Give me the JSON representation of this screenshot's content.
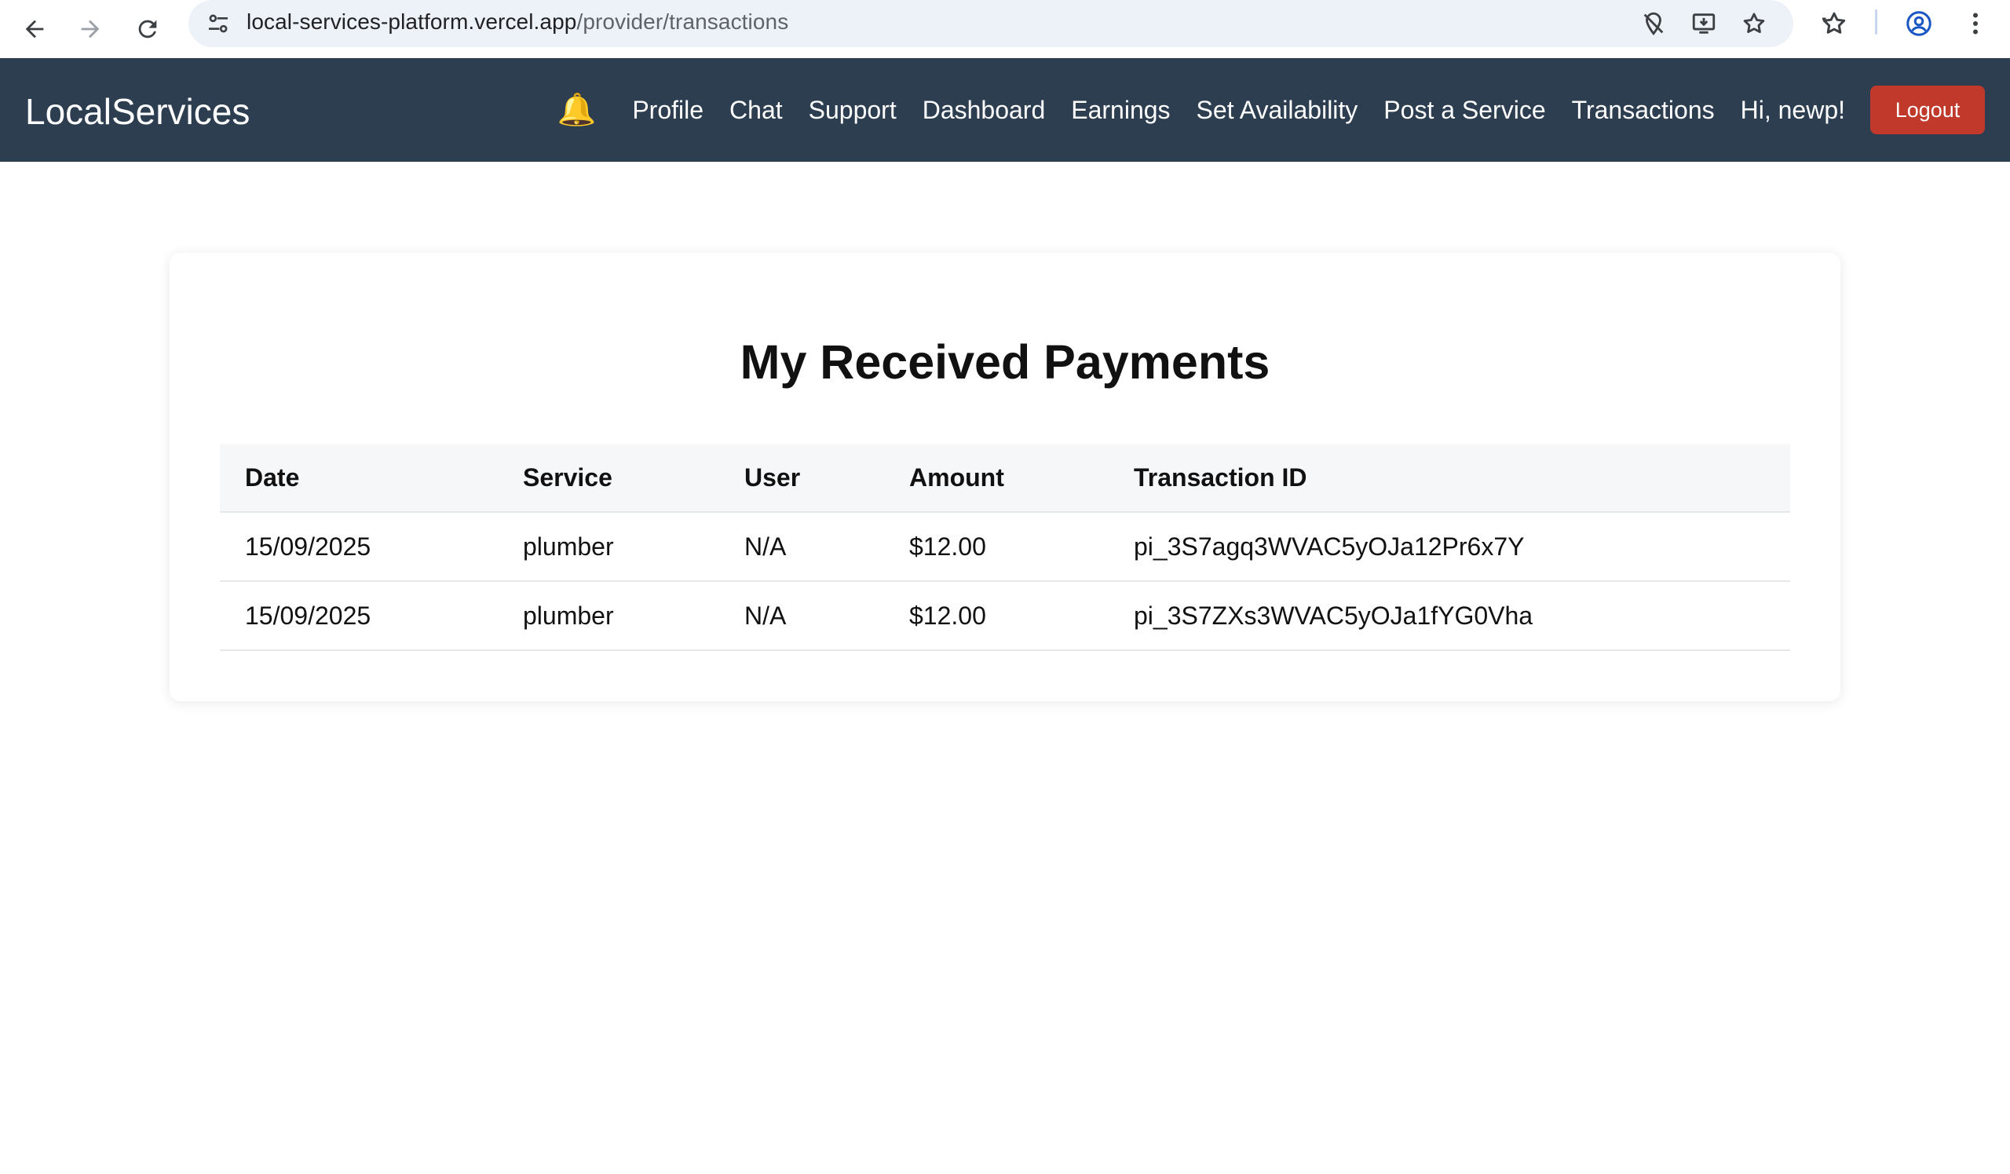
{
  "browser": {
    "url_host": "local-services-platform.vercel.app",
    "url_path": "/provider/transactions",
    "icons": [
      "back-icon",
      "forward-icon",
      "reload-icon",
      "site-settings-icon",
      "location-off-icon",
      "install-app-icon",
      "bookmark-star-icon",
      "bookmarks-icon",
      "profile-icon",
      "menu-icon"
    ]
  },
  "navbar": {
    "brand": "LocalServices",
    "bell": "🔔",
    "links": [
      "Profile",
      "Chat",
      "Support",
      "Dashboard",
      "Earnings",
      "Set Availability",
      "Post a Service",
      "Transactions"
    ],
    "greeting": "Hi, newp!",
    "logout_label": "Logout",
    "colors": {
      "background": "#2c3e50",
      "logout": "#c0392b"
    }
  },
  "main": {
    "title": "My Received Payments",
    "table": {
      "headers": [
        "Date",
        "Service",
        "User",
        "Amount",
        "Transaction ID"
      ],
      "rows": [
        [
          "15/09/2025",
          "plumber",
          "N/A",
          "$12.00",
          "pi_3S7agq3WVAC5yOJa12Pr6x7Y"
        ],
        [
          "15/09/2025",
          "plumber",
          "N/A",
          "$12.00",
          "pi_3S7ZXs3WVAC5yOJa1fYG0Vha"
        ]
      ]
    }
  }
}
